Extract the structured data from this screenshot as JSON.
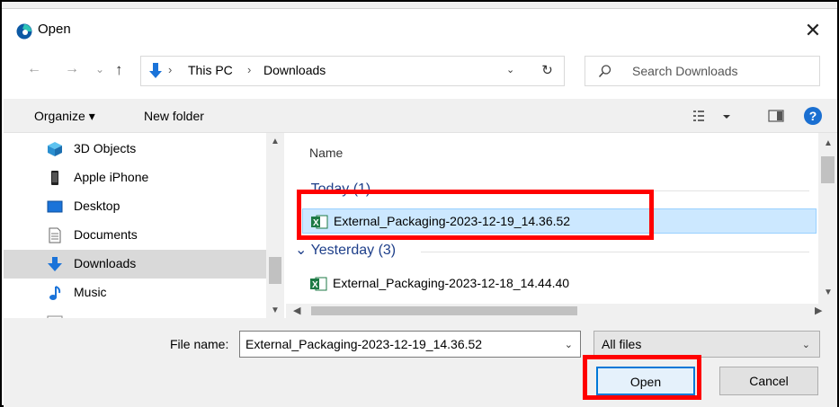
{
  "dialog": {
    "title": "Open",
    "close_glyph": "✕"
  },
  "nav": {
    "back_glyph": "←",
    "forward_glyph": "→",
    "recent_glyph": "⌄",
    "up_glyph": "↑",
    "path_sep": "›",
    "path": [
      "This PC",
      "Downloads"
    ],
    "dropdown_glyph": "⌄",
    "refresh_glyph": "↻",
    "search_placeholder": "Search Downloads"
  },
  "toolbar": {
    "organize_label": "Organize ▾",
    "new_folder_label": "New folder",
    "help_label": "?"
  },
  "sidebar": {
    "items": [
      {
        "label": "3D Objects",
        "icon": "3d-objects-icon"
      },
      {
        "label": "Apple iPhone",
        "icon": "phone-icon"
      },
      {
        "label": "Desktop",
        "icon": "desktop-icon"
      },
      {
        "label": "Documents",
        "icon": "documents-icon"
      },
      {
        "label": "Downloads",
        "icon": "downloads-icon",
        "selected": true
      },
      {
        "label": "Music",
        "icon": "music-icon"
      }
    ]
  },
  "files": {
    "column_name": "Name",
    "groups": [
      {
        "label": "Today (1)",
        "items": [
          {
            "name": "External_Packaging-2023-12-19_14.36.52",
            "selected": true
          }
        ]
      },
      {
        "label": "Yesterday (3)",
        "items": [
          {
            "name": "External_Packaging-2023-12-18_14.44.40",
            "selected": false
          }
        ]
      }
    ]
  },
  "bottom": {
    "file_name_label": "File name:",
    "file_name_value": "External_Packaging-2023-12-19_14.36.52",
    "filter_value": "All files",
    "open_label": "Open",
    "cancel_label": "Cancel"
  },
  "colors": {
    "accent": "#0078d7",
    "highlight": "#ff0000",
    "selection": "#cce8ff",
    "group_text": "#1e3f8a"
  }
}
